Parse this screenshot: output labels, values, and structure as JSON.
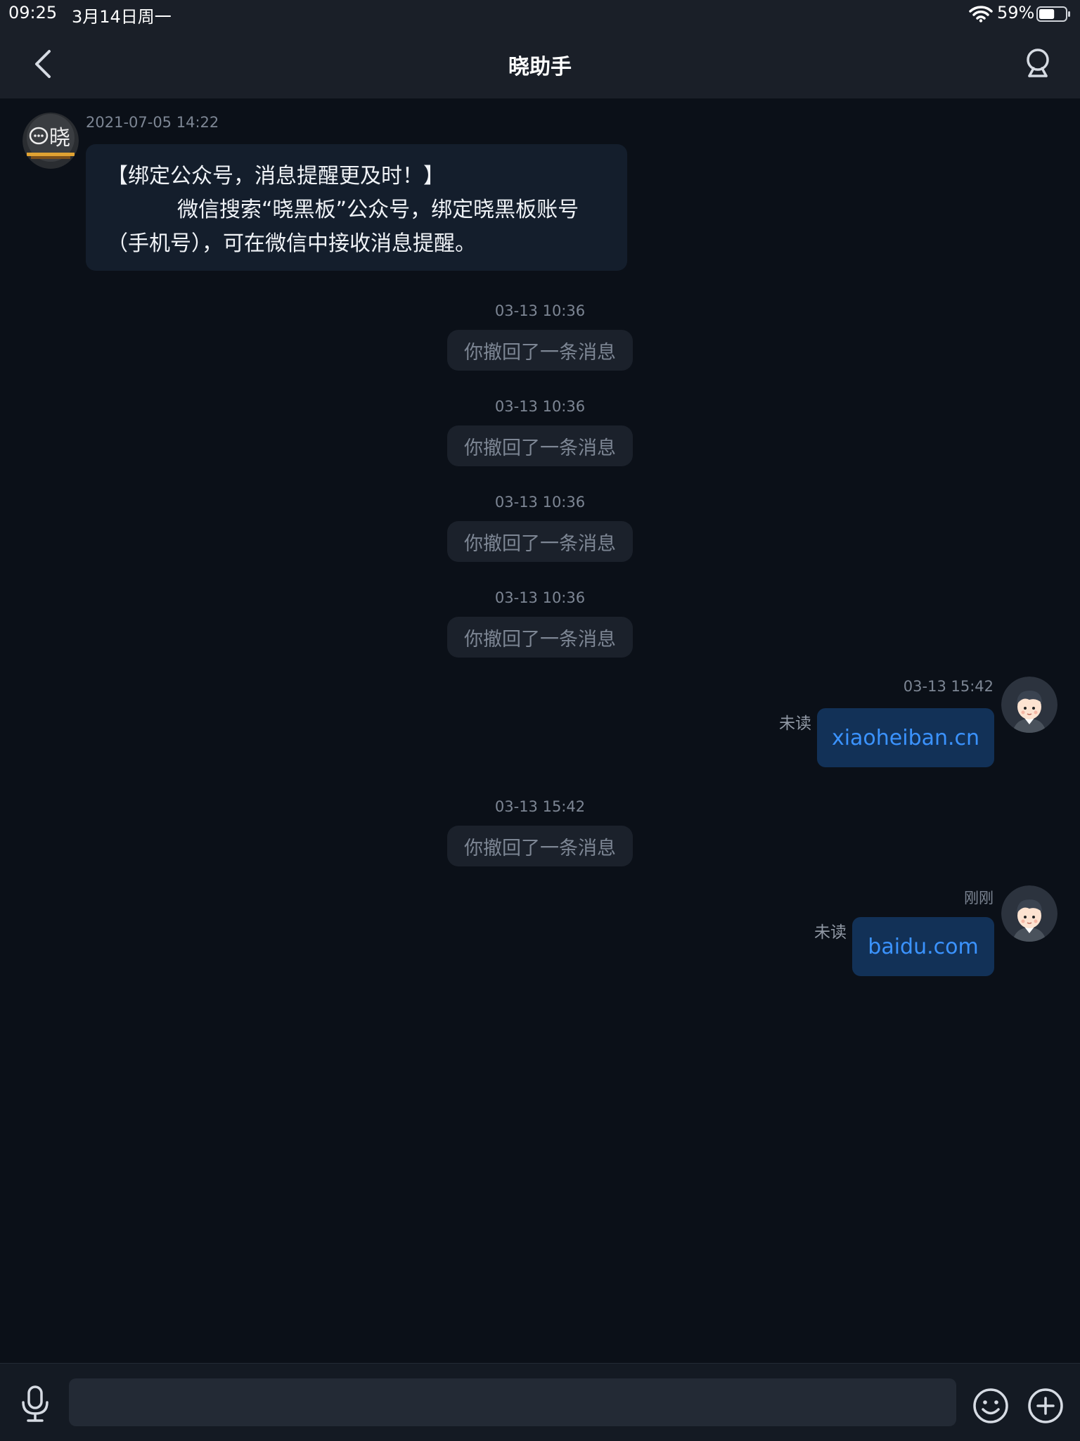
{
  "status_bar": {
    "time": "09:25",
    "date": "3月14日周一",
    "battery_percent": "59%",
    "battery_level": 0.59
  },
  "header": {
    "title": "晓助手",
    "back_icon": "chevron-left-icon",
    "profile_icon": "user-icon"
  },
  "messages": {
    "m1": {
      "timestamp": "2021-07-05 14:22",
      "avatar_text": "晓",
      "line1": "【绑定公众号，消息提醒更及时！】",
      "line2": "微信搜索“晓黑板”公众号，绑定晓黑板账号",
      "line3": "（手机号），可在微信中接收消息提醒。"
    },
    "r1": {
      "timestamp": "03-13 10:36",
      "text": "你撤回了一条消息"
    },
    "r2": {
      "timestamp": "03-13 10:36",
      "text": "你撤回了一条消息"
    },
    "r3": {
      "timestamp": "03-13 10:36",
      "text": "你撤回了一条消息"
    },
    "r4": {
      "timestamp": "03-13 10:36",
      "text": "你撤回了一条消息"
    },
    "s1": {
      "timestamp": "03-13 15:42",
      "status": "未读",
      "text": "xiaoheiban.cn"
    },
    "r5": {
      "timestamp": "03-13 15:42",
      "text": "你撤回了一条消息"
    },
    "s2": {
      "timestamp": "刚刚",
      "status": "未读",
      "text": "baidu.com"
    }
  },
  "input_bar": {
    "placeholder": "",
    "value": "",
    "icons": [
      "microphone-icon",
      "emoji-icon",
      "plus-icon"
    ]
  },
  "colors": {
    "background": "#0b1018",
    "header": "#1a1f28",
    "link": "#3b93ff",
    "sent_bubble": "#123157",
    "received_bubble": "#141e2c"
  }
}
